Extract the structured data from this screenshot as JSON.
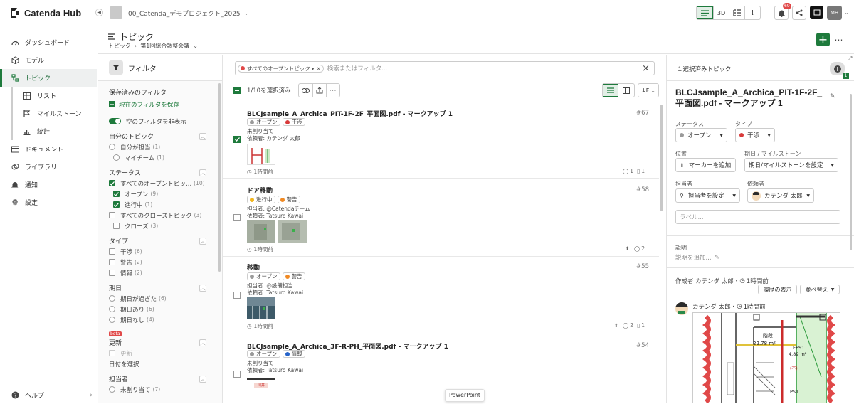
{
  "brand": {
    "name": "Catenda Hub"
  },
  "project": {
    "name": "00_Catenda_デモプロジェクト_2025"
  },
  "topbar": {
    "view_3d": "3D",
    "notif_count": "69",
    "user_initials": "MH"
  },
  "nav": {
    "items": [
      {
        "label": "ダッシュボード"
      },
      {
        "label": "モデル"
      },
      {
        "label": "トピック"
      },
      {
        "label": "リスト"
      },
      {
        "label": "マイルストーン"
      },
      {
        "label": "統計"
      },
      {
        "label": "ドキュメント"
      },
      {
        "label": "ライブラリ"
      },
      {
        "label": "通知"
      },
      {
        "label": "設定"
      }
    ],
    "help": "ヘルプ"
  },
  "page": {
    "title": "トピック",
    "breadcrumb_root": "トピック",
    "breadcrumb_current": "第1回総合調整会議"
  },
  "filter": {
    "header": "フィルタ",
    "saved_title": "保存済みのフィルタ",
    "save_current": "現在のフィルタを保存",
    "hide_empty": "空のフィルタを非表示",
    "sections": {
      "mine": {
        "title": "自分のトピック",
        "rows": [
          {
            "label": "自分が担当",
            "count": "(1)"
          },
          {
            "label": "マイチーム",
            "count": "(1)"
          }
        ]
      },
      "status": {
        "title": "ステータス",
        "rows": [
          {
            "label": "すべてのオープントピッ...",
            "count": "(10)"
          },
          {
            "label": "オープン",
            "count": "(9)"
          },
          {
            "label": "進行中",
            "count": "(1)"
          },
          {
            "label": "すべてのクローズトピック",
            "count": "(3)"
          },
          {
            "label": "クローズ",
            "count": "(3)"
          }
        ]
      },
      "type": {
        "title": "タイプ",
        "rows": [
          {
            "label": "干渉",
            "count": "(6)"
          },
          {
            "label": "警告",
            "count": "(2)"
          },
          {
            "label": "情報",
            "count": "(2)"
          }
        ]
      },
      "due": {
        "title": "期日",
        "rows": [
          {
            "label": "期日が過ぎた",
            "count": "(6)"
          },
          {
            "label": "期日あり",
            "count": "(6)"
          },
          {
            "label": "期日なし",
            "count": "(4)"
          }
        ]
      },
      "updated": {
        "badge": "beta",
        "title": "更新",
        "rows": [
          {
            "label": "更新"
          }
        ],
        "pick_date": "日付を選択"
      },
      "assignee": {
        "title": "担当者",
        "rows": [
          {
            "label": "未割り当て",
            "count": "(7)"
          }
        ]
      }
    }
  },
  "search": {
    "chip": "すべてのオープントピック",
    "placeholder": "検索またはフィルタ..."
  },
  "list_toolbar": {
    "selected": "1/10を選択済み"
  },
  "topics": [
    {
      "title": "BLCJsample_A_Archica_PIT-1F-2F_平面図.pdf - マークアップ 1",
      "num": "#67",
      "status": "オープン",
      "type": "干渉",
      "line1": "未割り当て",
      "line2": "依頼者: カテンダ 太郎",
      "time": "1時間前",
      "comments": "1",
      "files": "1"
    },
    {
      "title": "ドア移動",
      "num": "#58",
      "status": "進行中",
      "type": "警告",
      "line1": "担当者: @Catendaチーム",
      "line2": "依頼者: Tatsuro Kawai",
      "time": "1時間前",
      "comments": "2"
    },
    {
      "title": "移動",
      "num": "#55",
      "status": "オープン",
      "type": "警告",
      "line1": "担当者: @設備担当",
      "line2": "依頼者: Tatsuro Kawai",
      "time": "1時間前",
      "comments": "2",
      "files": "1"
    },
    {
      "title": "BLCJsample_A_Archica_3F-R-PH_平面図.pdf - マークアップ 1",
      "num": "#54",
      "status": "オープン",
      "type": "情報",
      "line1": "未割り当て",
      "line2": "依頼者: Tatsuro Kawai",
      "thumb_text": "川井"
    }
  ],
  "tooltip": "PowerPoint",
  "detail": {
    "header": "１選択済みトピック",
    "badge": "1",
    "title": "BLCJsample_A_Archica_PIT-1F-2F_平面図.pdf - マークアップ 1",
    "status_label": "ステータス",
    "status_value": "オープン",
    "type_label": "タイプ",
    "type_value": "干渉",
    "position_label": "位置",
    "add_marker": "マーカーを追加",
    "due_label": "期日 / マイルストーン",
    "due_value": "期日/マイルストーンを設定",
    "assignee_label": "担当者",
    "assignee_value": "担当者を設定",
    "requester_label": "依頼者",
    "requester_value": "カテンダ 太郎",
    "labels_placeholder": "ラベル...",
    "description_label": "説明",
    "description_add": "説明を追加...",
    "created_by": "作成者 カテンダ 太郎・",
    "created_time": "1時間前",
    "history_button": "履歴の表示",
    "sort_button": "並べ替え",
    "comment_author": "カテンダ 太郎・",
    "comment_time": "1時間前",
    "drawing": {
      "room_name": "階段",
      "room_area": "22.78 m²",
      "eps": "EPS1",
      "eps_area": "4.89 m²",
      "ps": "PS1",
      "fire": "(不)"
    }
  },
  "colors": {
    "accent": "#1e7a3c",
    "open": "#9a9a9a",
    "clash": "#d83a3a",
    "warning": "#f08a24",
    "info": "#2563c9",
    "progress": "#f2b51c"
  }
}
